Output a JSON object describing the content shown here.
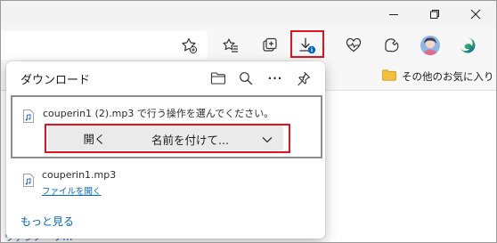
{
  "colors": {
    "accent": "#0067c0",
    "highlight_red": "#e0141e",
    "button_bg": "#eaeaea"
  },
  "window": {
    "controls": [
      "minimize-icon",
      "restore-icon",
      "close-icon"
    ]
  },
  "toolbar": {
    "icons": [
      "add-favorite-icon",
      "favorites-icon",
      "collections-icon",
      "downloads-icon",
      "health-icon",
      "extensions-icon",
      "profile-avatar",
      "edge-copilot-icon"
    ]
  },
  "favorites_bar": {
    "other_favorites": "その他のお気に入り"
  },
  "downloads": {
    "title": "ダウンロード",
    "header_icons": [
      "open-folder-icon",
      "search-icon",
      "more-icon",
      "pin-icon"
    ],
    "more_label": "···",
    "items": [
      {
        "prompt": "couperin1 (2).mp3 で行う操作を選んでください。",
        "open_label": "開く",
        "save_as_label": "名前を付けて..."
      },
      {
        "filename": "couperin1.mp3",
        "action_link": "ファイルを開く"
      }
    ],
    "see_more": "もっと見る"
  },
  "background": {
    "partial_text": "ウァンノ・ソm"
  }
}
